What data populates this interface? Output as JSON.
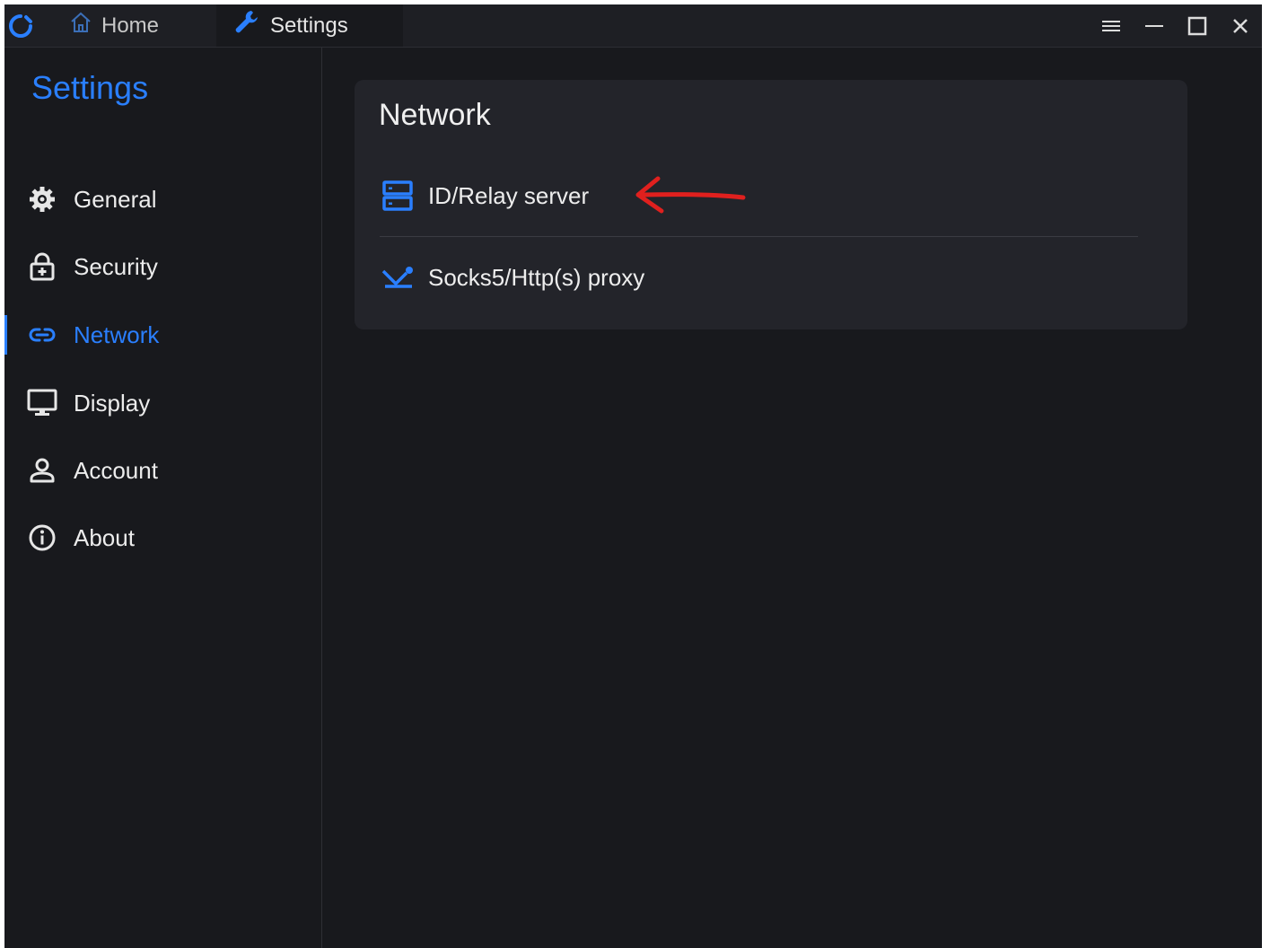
{
  "titlebar": {
    "tabs": [
      {
        "label": "Home",
        "icon": "home-icon"
      },
      {
        "label": "Settings",
        "icon": "wrench-icon"
      }
    ],
    "controls": [
      "menu-icon",
      "minimize-icon",
      "maximize-icon",
      "close-icon"
    ]
  },
  "sidebar": {
    "title": "Settings",
    "items": [
      {
        "label": "General",
        "icon": "gear-icon"
      },
      {
        "label": "Security",
        "icon": "lock-icon"
      },
      {
        "label": "Network",
        "icon": "link-icon",
        "active": true
      },
      {
        "label": "Display",
        "icon": "monitor-icon"
      },
      {
        "label": "Account",
        "icon": "person-icon"
      },
      {
        "label": "About",
        "icon": "info-icon"
      }
    ]
  },
  "main": {
    "card": {
      "title": "Network",
      "rows": [
        {
          "label": "ID/Relay server",
          "icon": "server-icon"
        },
        {
          "label": "Socks5/Http(s) proxy",
          "icon": "proxy-icon"
        }
      ]
    }
  },
  "colors": {
    "accent": "#2a7fff",
    "background": "#18191d",
    "card": "#23242a",
    "annotation": "#e0201e"
  }
}
